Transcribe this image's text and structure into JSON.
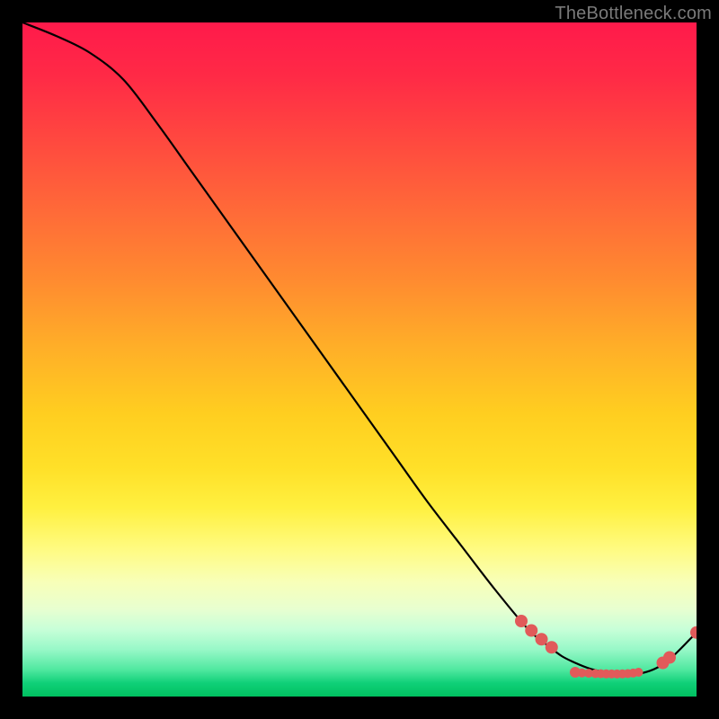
{
  "attribution": "TheBottleneck.com",
  "chart_data": {
    "type": "line",
    "title": "",
    "xlabel": "",
    "ylabel": "",
    "xlim": [
      0,
      100
    ],
    "ylim": [
      0,
      100
    ],
    "grid": false,
    "legend": false,
    "series": [
      {
        "name": "curve",
        "x": [
          0,
          5,
          10,
          15,
          20,
          25,
          30,
          35,
          40,
          45,
          50,
          55,
          60,
          65,
          70,
          75,
          78,
          80,
          82,
          84,
          86,
          88,
          90,
          92,
          94,
          96,
          100
        ],
        "y": [
          100,
          98,
          95.5,
          91.5,
          85,
          78,
          71,
          64,
          57,
          50,
          43,
          36,
          29,
          22.5,
          16,
          10,
          7.5,
          6,
          5,
          4.2,
          3.7,
          3.4,
          3.3,
          3.5,
          4.2,
          5.5,
          9.5
        ]
      }
    ],
    "markers": [
      {
        "x": 74,
        "y": 11.2,
        "r": 7
      },
      {
        "x": 75.5,
        "y": 9.8,
        "r": 7
      },
      {
        "x": 77,
        "y": 8.5,
        "r": 7
      },
      {
        "x": 78.5,
        "y": 7.3,
        "r": 7
      },
      {
        "x": 82,
        "y": 3.6,
        "r": 6
      },
      {
        "x": 83,
        "y": 3.5,
        "r": 5
      },
      {
        "x": 84,
        "y": 3.45,
        "r": 5
      },
      {
        "x": 85,
        "y": 3.4,
        "r": 5
      },
      {
        "x": 85.8,
        "y": 3.38,
        "r": 5
      },
      {
        "x": 86.6,
        "y": 3.36,
        "r": 5
      },
      {
        "x": 87.4,
        "y": 3.35,
        "r": 5
      },
      {
        "x": 88.2,
        "y": 3.35,
        "r": 5
      },
      {
        "x": 89,
        "y": 3.36,
        "r": 5
      },
      {
        "x": 89.8,
        "y": 3.4,
        "r": 5
      },
      {
        "x": 90.6,
        "y": 3.48,
        "r": 5
      },
      {
        "x": 91.4,
        "y": 3.6,
        "r": 5
      },
      {
        "x": 95,
        "y": 5.0,
        "r": 7
      },
      {
        "x": 96,
        "y": 5.8,
        "r": 7
      },
      {
        "x": 100,
        "y": 9.5,
        "r": 7
      }
    ],
    "marker_color": "#e15a5a",
    "line_color": "#000000"
  }
}
